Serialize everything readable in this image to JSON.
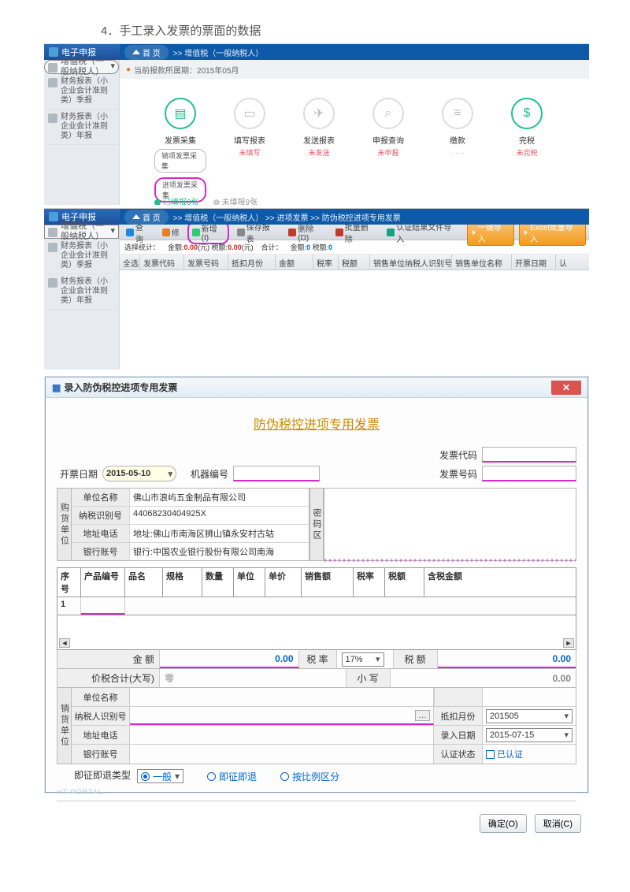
{
  "heading": "4．手工录入发票的票面的数据",
  "section1": {
    "app_title": "电子申报",
    "home_tab": "首 页",
    "crumb_suffix": "增值税（一般纳税人）",
    "period_label": "当前报款所属期：",
    "period_value": "2015年05月",
    "sidemenu": [
      "增值税（一般纳税人）",
      "财务报表（小企业会计准则类）季报",
      "财务报表（小企业会计准则类）年报"
    ],
    "cards": [
      {
        "label": "发票采集",
        "status": "",
        "buttons": [
          "销项发票采集",
          "进项发票采集"
        ]
      },
      {
        "label": "填写报表",
        "status": "未填写"
      },
      {
        "label": "发送报表",
        "status": "未发送"
      },
      {
        "label": "申报查询",
        "status": "未申报"
      },
      {
        "label": "缴款",
        "status": "……"
      },
      {
        "label": "完税",
        "status": "未完税"
      }
    ],
    "progress": {
      "done": "已填报0张",
      "remain": "未填报9张"
    }
  },
  "section2": {
    "app_title": "电子申报",
    "crumbs": "增值税（一般纳税人） >> 进项发票 >> 防伪税控进项专用发票",
    "toolbar": [
      {
        "id": "search",
        "label": "查询",
        "icon": "#1e88e5"
      },
      {
        "id": "edit",
        "label": "修",
        "icon": "#e67e22"
      },
      {
        "id": "add",
        "label": "新增(I)",
        "icon": "#2ecc71",
        "hl": true
      },
      {
        "id": "save",
        "label": "保存报表",
        "icon": "#888"
      },
      {
        "id": "delete",
        "label": "删除(D)",
        "icon": "#c0392b"
      },
      {
        "id": "batchdel",
        "label": "批量删除",
        "icon": "#c0392b"
      },
      {
        "id": "import",
        "label": "认证结果文件导入",
        "icon": "#16a085"
      }
    ],
    "bigbuttons": [
      {
        "id": "onekey",
        "label": "一键导入"
      },
      {
        "id": "excel",
        "label": "Excel批量导入"
      }
    ],
    "summary": {
      "selected_label": "选择统计：",
      "sel_amount": "金额:",
      "sel_amount_v": "0.00",
      "sel_tax": "(元)  税额:",
      "sel_tax_v": "0.00",
      "unit": "(元)",
      "total_label": "合计：",
      "tot_amount": "金额:",
      "tot_amount_v": "0",
      "tot_tax": "税额:",
      "tot_tax_v": "0"
    },
    "grid_headers": [
      "全选",
      "发票代码",
      "发票号码",
      "抵扣月份",
      "金额",
      "税率",
      "税额",
      "销售单位纳税人识别号",
      "销售单位名称",
      "开票日期",
      "认"
    ]
  },
  "dialog": {
    "title": "录入防伪税控进项专用发票",
    "h2": "防伪税控进项专用发票",
    "labels": {
      "date": "开票日期",
      "machine": "机器编号",
      "inv_code": "发票代码",
      "inv_no": "发票号码"
    },
    "date_value": "2015-05-10",
    "buyer": {
      "vlabel": "购货单位",
      "rows": [
        {
          "label": "单位名称",
          "value": "佛山市浪屿五金制品有限公司"
        },
        {
          "label": "纳税识别号",
          "value": "44068230404925X"
        },
        {
          "label": "地址电话",
          "value": "地址:佛山市南海区狮山镇永安村古轱"
        },
        {
          "label": "银行账号",
          "value": "银行:中国农业银行股份有限公司南海"
        }
      ],
      "sidebox": "密码区"
    },
    "table": {
      "headers": [
        "序号",
        "产品编号",
        "品名",
        "规格",
        "数量",
        "单位",
        "单价",
        "销售额",
        "税率",
        "税额",
        "含税金额"
      ],
      "row1_seq": "1"
    },
    "calc": {
      "amount_label": "金   额",
      "amount_value": "0.00",
      "rate_label": "税 率",
      "rate_value": "17%",
      "tax_label": "税   额",
      "tax_value": "0.00",
      "total_cn_label": "价税合计(大写)",
      "total_cn_value": "零",
      "small_label": "小 写",
      "small_value": "0.00"
    },
    "seller": {
      "vlabel": "销货单位",
      "rows": [
        {
          "label": "单位名称",
          "value": ""
        },
        {
          "label": "纳税人识别号",
          "value": "",
          "ellipsis": "…"
        },
        {
          "label": "地址电话",
          "value": ""
        },
        {
          "label": "银行账号",
          "value": ""
        }
      ],
      "right": [
        {
          "label": "抵扣月份",
          "value": "201505"
        },
        {
          "label": "录入日期",
          "value": "2015-07-15"
        },
        {
          "label": "认证状态",
          "value": "已认证",
          "checkbox": true
        }
      ]
    },
    "refund": {
      "label": "即征即退类型",
      "options": [
        "一般",
        "即征即退",
        "按比例区分"
      ]
    },
    "portal": "HT-PORTAL",
    "buttons": {
      "ok": "确定(O)",
      "cancel": "取消(C)"
    }
  }
}
